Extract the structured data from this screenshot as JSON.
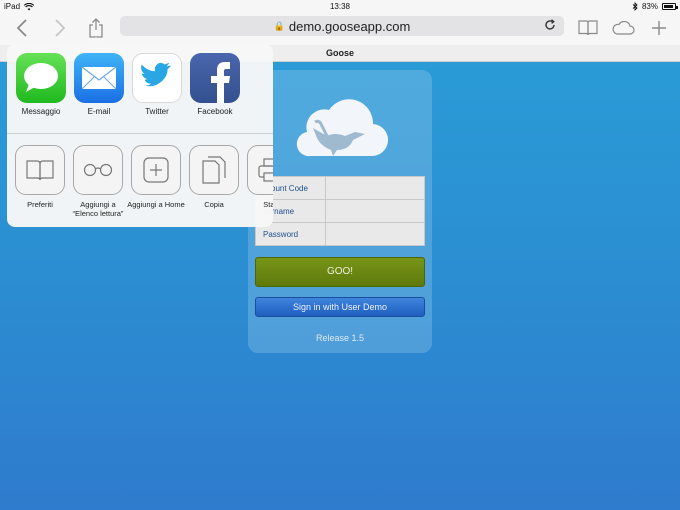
{
  "status_bar": {
    "device": "iPad",
    "time": "13:38",
    "battery": "83%"
  },
  "browser": {
    "url": "demo.gooseapp.com",
    "tab_title": "Goose"
  },
  "share_sheet": {
    "apps": [
      {
        "label": "Messaggio",
        "icon": "messages-icon"
      },
      {
        "label": "E-mail",
        "icon": "mail-icon"
      },
      {
        "label": "Twitter",
        "icon": "twitter-icon"
      },
      {
        "label": "Facebook",
        "icon": "facebook-icon"
      }
    ],
    "actions": [
      {
        "label": "Preferiti",
        "icon": "book-icon"
      },
      {
        "label": "Aggiungi a “Elenco lettura”",
        "icon": "glasses-icon"
      },
      {
        "label": "Aggiungi a Home",
        "icon": "plus-icon"
      },
      {
        "label": "Copia",
        "icon": "copy-icon"
      },
      {
        "label": "Stam",
        "icon": "print-icon"
      }
    ]
  },
  "login": {
    "fields": [
      {
        "label": "Account Code",
        "visible": "ccount Code"
      },
      {
        "label": "Username",
        "visible": "sername"
      },
      {
        "label": "Password",
        "visible": "Password"
      }
    ],
    "goo_button": "GOO!",
    "demo_button": "Sign in with User Demo",
    "release": "Release 1.5"
  },
  "colors": {
    "background_top": "#2a9fd8",
    "background_bottom": "#2f7bcd",
    "goo_button": "#6c8712",
    "demo_button": "#2d6fd0"
  }
}
